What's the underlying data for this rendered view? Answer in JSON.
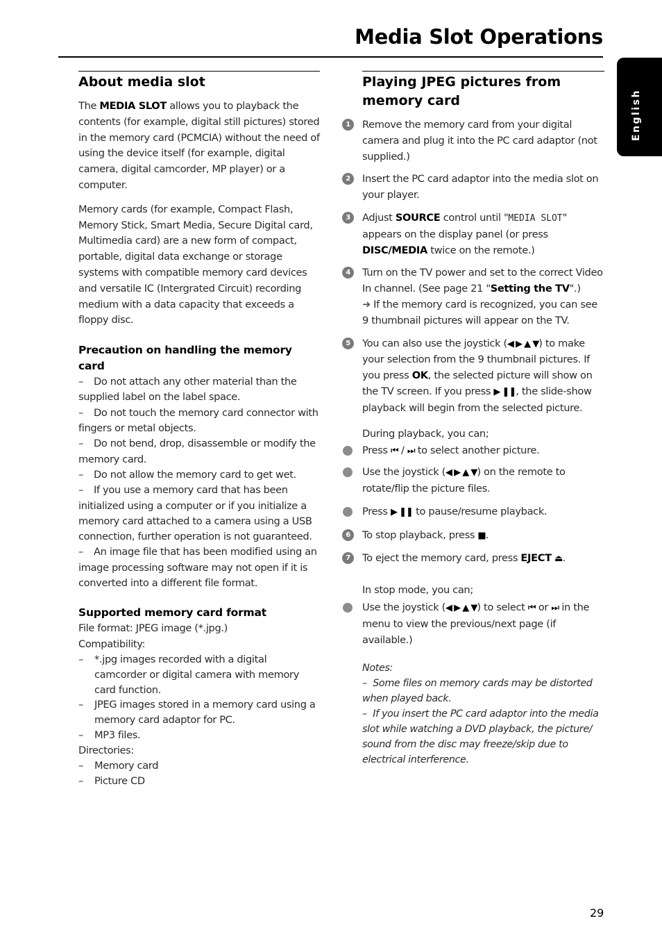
{
  "header": {
    "title": "Media Slot Operations",
    "language_tab": "English"
  },
  "left": {
    "about": {
      "heading": "About media slot",
      "p1_pre": "The ",
      "p1_bold": "MEDIA SLOT",
      "p1_post": " allows you to playback the contents (for example, digital still pictures) stored in the memory card (PCMCIA) without the need of using the device itself (for example, digital camera, digital camcorder, MP player) or a computer.",
      "p2": "Memory cards (for example, Compact Flash, Memory Stick, Smart Media, Secure Digital card, Multimedia card) are a new form of compact, portable, digital data exchange or storage systems with compatible memory card devices and versatile IC (Intergrated Circuit) recording medium with a data capacity that exceeds a floppy disc."
    },
    "precaution": {
      "heading": "Precaution on handling the memory card",
      "items": [
        "Do not attach any other material than the supplied label on the label space.",
        "Do not touch the memory card connector with fingers or metal objects.",
        "Do not bend, drop, disassemble or modify the memory card.",
        "Do not allow the memory card to get wet.",
        "If you use a memory card that has been initialized using a computer or if you initialize a memory card attached to a camera using a USB connection, further operation is not guaranteed.",
        "An image file that has been modified using an image processing software may not open if it is converted into a different file format."
      ]
    },
    "supported": {
      "heading": "Supported memory card format",
      "file_format": "File format: JPEG image (*.jpg.)",
      "compat_label": "Compatibility:",
      "compat_items": [
        "*.jpg images recorded with a digital camcorder or digital camera with memory card function.",
        "JPEG images stored in a memory card using a memory card adaptor for PC.",
        "MP3 files."
      ],
      "dir_label": "Directories:",
      "dir_items": [
        "Memory card",
        "Picture CD"
      ]
    }
  },
  "right": {
    "heading": "Playing JPEG pictures from memory card",
    "dash": "–",
    "step1": {
      "num": "1",
      "text": "Remove the memory card from your digital camera and plug it into the PC card adaptor (not supplied.)"
    },
    "step2": {
      "num": "2",
      "text": "Insert the PC card adaptor into the media slot on your player."
    },
    "step3": {
      "num": "3",
      "pre": "Adjust ",
      "b1": "SOURCE",
      "mid": " control until \"",
      "display": "MEDIA SLOT",
      "mid2": "\" appears on the display panel (or press ",
      "b2": "DISC/MEDIA",
      "post": " twice on the remote.)"
    },
    "step4": {
      "num": "4",
      "pre": "Turn on the TV power and set to the correct Video In channel.  (See page 21 \"",
      "bold": "Setting the TV",
      "post": "\".)",
      "arrow": "➜",
      "result": " If the memory card is recognized, you can see 9 thumbnail pictures will appear on the TV."
    },
    "step5": {
      "num": "5",
      "pre": "You can also use the joystick (",
      "joystick": "◀ ▶ ▲ ▼",
      "mid": ") to make your selection from the 9 thumbnail pictures.  If you press ",
      "ok": "OK",
      "mid2": ", the selected picture will show on the TV screen.  If you press ",
      "playpause": "▶ ❚❚",
      "post": ", the slide-show playback will begin from the selected picture."
    },
    "during_label": "During playback, you can;",
    "bullet1": {
      "pre": "Press ",
      "prev": "⏮",
      "sep": " / ",
      "next": "⏭",
      "post": " to select another picture."
    },
    "bullet2": {
      "pre": "Use the joystick (",
      "joystick": "◀ ▶ ▲ ▼",
      "post": ") on the remote to rotate/flip the picture files."
    },
    "bullet3": {
      "pre": "Press ",
      "playpause": "▶ ❚❚",
      "post": " to pause/resume playback."
    },
    "step6": {
      "num": "6",
      "pre": "To stop playback, press ",
      "stop": "■",
      "post": "."
    },
    "step7": {
      "num": "7",
      "pre": "To eject the memory card, press ",
      "bold": "EJECT",
      "eject": "⏏",
      "post": "."
    },
    "stop_label": "In stop mode, you can;",
    "bullet4": {
      "pre": "Use the joystick (",
      "joystick": "◀ ▶ ▲ ▼",
      "mid": ") to select ",
      "prev": "⏮",
      "or": " or ",
      "next": "⏭",
      "post": " in the menu to view the previous/next page (if available.)"
    },
    "notes": {
      "label": "Notes:",
      "items": [
        "Some files on memory cards may be distorted when played back.",
        "If you insert the PC card adaptor into the media slot while watching a DVD playback, the picture/ sound from the disc may freeze/skip due to electrical interference."
      ]
    }
  },
  "footer": {
    "page_number": "29"
  }
}
